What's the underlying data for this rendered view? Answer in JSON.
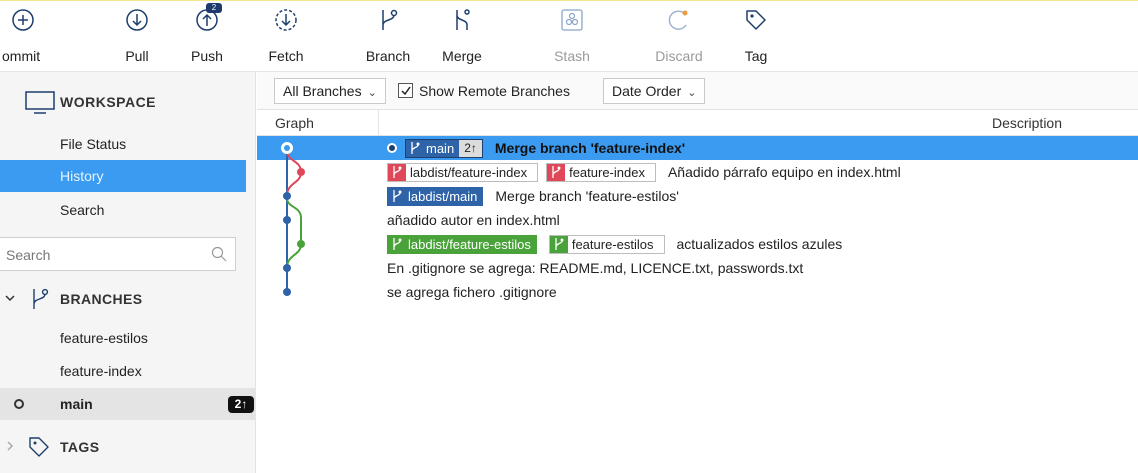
{
  "toolbar": {
    "commit": "ommit",
    "pull": "Pull",
    "push": "Push",
    "push_badge": "2",
    "fetch": "Fetch",
    "branch": "Branch",
    "merge": "Merge",
    "stash": "Stash",
    "discard": "Discard",
    "tag": "Tag"
  },
  "sidebar": {
    "workspace": "WORKSPACE",
    "items": [
      "File Status",
      "History",
      "Search"
    ],
    "selected": "History",
    "search_placeholder": "Search",
    "branches_header": "BRANCHES",
    "branches": [
      {
        "name": "feature-estilos"
      },
      {
        "name": "feature-index"
      },
      {
        "name": "main",
        "current": true,
        "ahead": "2↑"
      }
    ],
    "tags_header": "TAGS"
  },
  "filters": {
    "branches": "All Branches",
    "show_remote": "Show Remote Branches",
    "show_remote_checked": true,
    "order": "Date Order"
  },
  "columns": {
    "graph": "Graph",
    "description": "Description"
  },
  "commits": [
    {
      "message": "Merge branch 'feature-index'",
      "selected": true,
      "refs": [
        {
          "name": "main",
          "ahead": "2↑",
          "color": "#1d3f6e",
          "head": true
        }
      ]
    },
    {
      "message": "Añadido párrafo equipo en index.html",
      "refs": [
        {
          "name": "labdist/feature-index",
          "color": "#e0485a"
        },
        {
          "name": "feature-index",
          "color": "#e0485a"
        }
      ]
    },
    {
      "message": "Merge branch 'feature-estilos'",
      "refs": [
        {
          "name": "labdist/main",
          "color": "#2f63a8"
        }
      ]
    },
    {
      "message": "añadido autor en index.html",
      "refs": []
    },
    {
      "message": "actualizados estilos azules",
      "refs": [
        {
          "name": "labdist/feature-estilos",
          "color": "#4aa33a"
        },
        {
          "name": "feature-estilos",
          "color": "#4aa33a"
        }
      ]
    },
    {
      "message": "En .gitignore se agrega: README.md, LICENCE.txt, passwords.txt",
      "refs": []
    },
    {
      "message": "se agrega fichero .gitignore",
      "refs": []
    }
  ],
  "colors": {
    "accent": "#3a9bf0",
    "main_lane": "#2f63a8",
    "index_lane": "#e0485a",
    "estilos_lane": "#4aa33a"
  }
}
